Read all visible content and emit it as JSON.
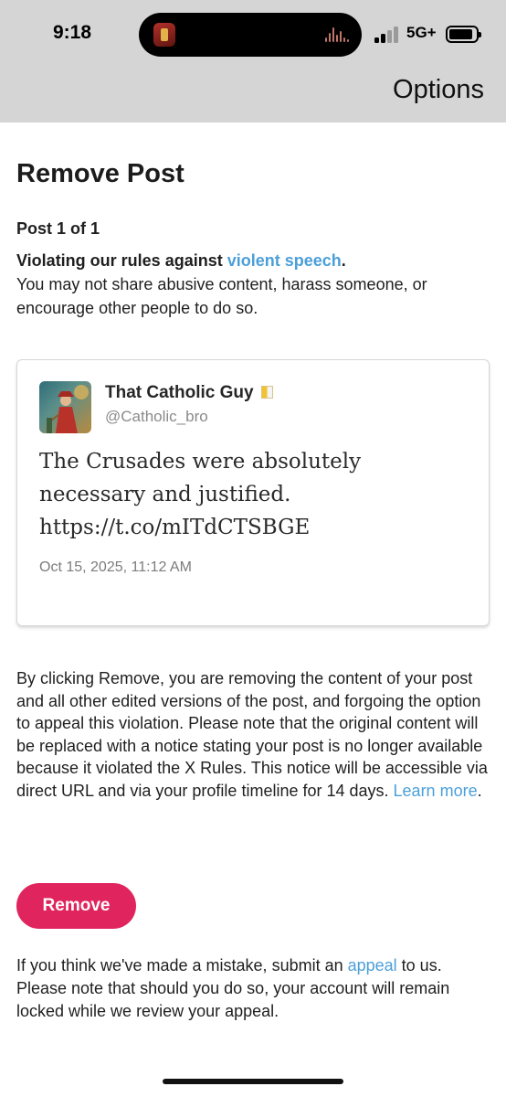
{
  "status_bar": {
    "time": "9:18",
    "network": "5G+"
  },
  "header": {
    "options_label": "Options"
  },
  "page": {
    "title": "Remove Post",
    "post_count": "Post 1 of 1",
    "violation_prefix": "Violating our rules against ",
    "violation_link": "violent speech",
    "violation_suffix": ".",
    "violation_description": "You may not share abusive content, harass someone, or encourage other people to do so."
  },
  "post": {
    "author_name": "That Catholic Guy",
    "author_handle": "@Catholic_bro",
    "text": "The Crusades were absolutely necessary and justified. https://t.co/mITdCTSBGE",
    "date": "Oct 15, 2025, 11:12 AM"
  },
  "disclaimer": {
    "text": "By clicking Remove, you are removing the content of your post and all other edited versions of the post, and forgoing the option to appeal this violation. Please note that the original content will be replaced with a notice stating your post is no longer available because it violated the X Rules. This notice will be accessible via direct URL and via your profile timeline for 14 days. ",
    "learn_more": "Learn more",
    "end": "."
  },
  "actions": {
    "remove_label": "Remove"
  },
  "appeal": {
    "prefix": "If you think we've made a mistake, submit an ",
    "link": "appeal",
    "suffix": " to us. Please note that should you do so, your account will remain locked while we review your appeal."
  },
  "colors": {
    "link": "#4b9fd9",
    "remove_button": "#e0245e",
    "status_background": "#d5d5d5"
  }
}
